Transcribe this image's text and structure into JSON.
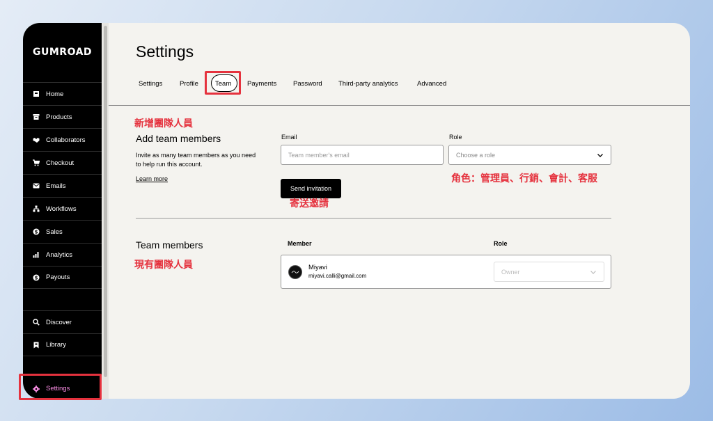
{
  "brand": {
    "logo": "GUMROAD"
  },
  "sidebar": {
    "items": [
      {
        "label": "Home",
        "icon": "home-icon"
      },
      {
        "label": "Products",
        "icon": "archive-icon"
      },
      {
        "label": "Collaborators",
        "icon": "handshake-icon"
      },
      {
        "label": "Checkout",
        "icon": "cart-icon"
      },
      {
        "label": "Emails",
        "icon": "envelope-icon"
      },
      {
        "label": "Workflows",
        "icon": "workflow-icon"
      },
      {
        "label": "Sales",
        "icon": "dollar-circle-icon"
      },
      {
        "label": "Analytics",
        "icon": "bar-chart-icon"
      },
      {
        "label": "Payouts",
        "icon": "dollar-circle-icon"
      }
    ],
    "secondary": [
      {
        "label": "Discover",
        "icon": "search-icon"
      },
      {
        "label": "Library",
        "icon": "bookmark-icon"
      }
    ],
    "settings": {
      "label": "Settings",
      "icon": "gear-icon"
    },
    "settings_color": "#ff90e8"
  },
  "page": {
    "title": "Settings"
  },
  "tabs": [
    {
      "label": "Settings"
    },
    {
      "label": "Profile"
    },
    {
      "label": "Team",
      "active": true
    },
    {
      "label": "Payments"
    },
    {
      "label": "Password"
    },
    {
      "label": "Third-party analytics"
    },
    {
      "label": "Advanced"
    }
  ],
  "add_team": {
    "heading": "Add team members",
    "description": "Invite as many team members as you need to help run this account.",
    "learn_more": "Learn more",
    "email_label": "Email",
    "email_placeholder": "Team member's email",
    "role_label": "Role",
    "role_placeholder": "Choose a role",
    "send_button": "Send invitation"
  },
  "team_members": {
    "heading": "Team members",
    "col_member": "Member",
    "col_role": "Role",
    "rows": [
      {
        "name": "Miyavi",
        "email": "miyavi.calli@gmail.com",
        "role": "Owner"
      }
    ]
  },
  "annotations": {
    "add_members": "新增團隊人員",
    "roles": "角色：管理員、行銷、會計、客服",
    "send": "寄送邀請",
    "current_members": "現有團隊人員",
    "color": "#e5323e"
  }
}
